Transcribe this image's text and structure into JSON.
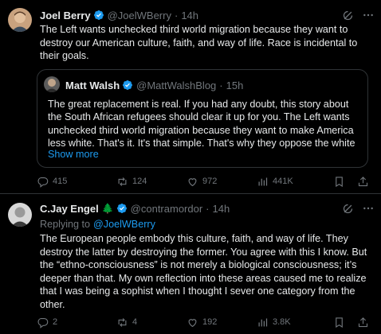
{
  "tweet1": {
    "author_name": "Joel Berry",
    "handle": "@JoelWBerry",
    "time": "14h",
    "text": "The Left wants unchecked third world migration because they want to destroy our American culture, faith, and way of life. Race is incidental to their goals.",
    "quote": {
      "author_name": "Matt Walsh",
      "handle": "@MattWalshBlog",
      "time": "15h",
      "text": "The great replacement is real. If you had any doubt, this story about the South African refugees should clear it up for you. The Left wants unchecked third world migration because they want to make America less white. That's it. It's that simple. That's why they oppose the white",
      "show_more": "Show more"
    },
    "replies": "415",
    "reposts": "124",
    "likes": "972",
    "views": "441K"
  },
  "tweet2": {
    "author_name": "C.Jay Engel",
    "emoji": "🌲",
    "handle": "@contramordor",
    "time": "14h",
    "replying_to_label": "Replying to",
    "replying_to_handle": "@JoelWBerry",
    "text": "The European people embody this culture, faith, and way of life. They destroy the latter by destroying the former. You agree with this I know. But the “ethno-consciousness” is not merely a biological consciousness; it’s deeper than that. My own reflection into these areas caused me to realize that I was being a sophist when I thought I sever one category from the other.",
    "replies": "2",
    "reposts": "4",
    "likes": "192",
    "views": "3.8K"
  },
  "colors": {
    "background": "#000000",
    "text": "#e7e9ea",
    "muted": "#71767b",
    "accent": "#1d9bf0",
    "border": "#2f3336"
  },
  "icons": [
    "verified-badge-icon",
    "grok-icon",
    "more-icon",
    "reply-icon",
    "repost-icon",
    "like-icon",
    "views-icon",
    "bookmark-icon",
    "share-icon"
  ]
}
